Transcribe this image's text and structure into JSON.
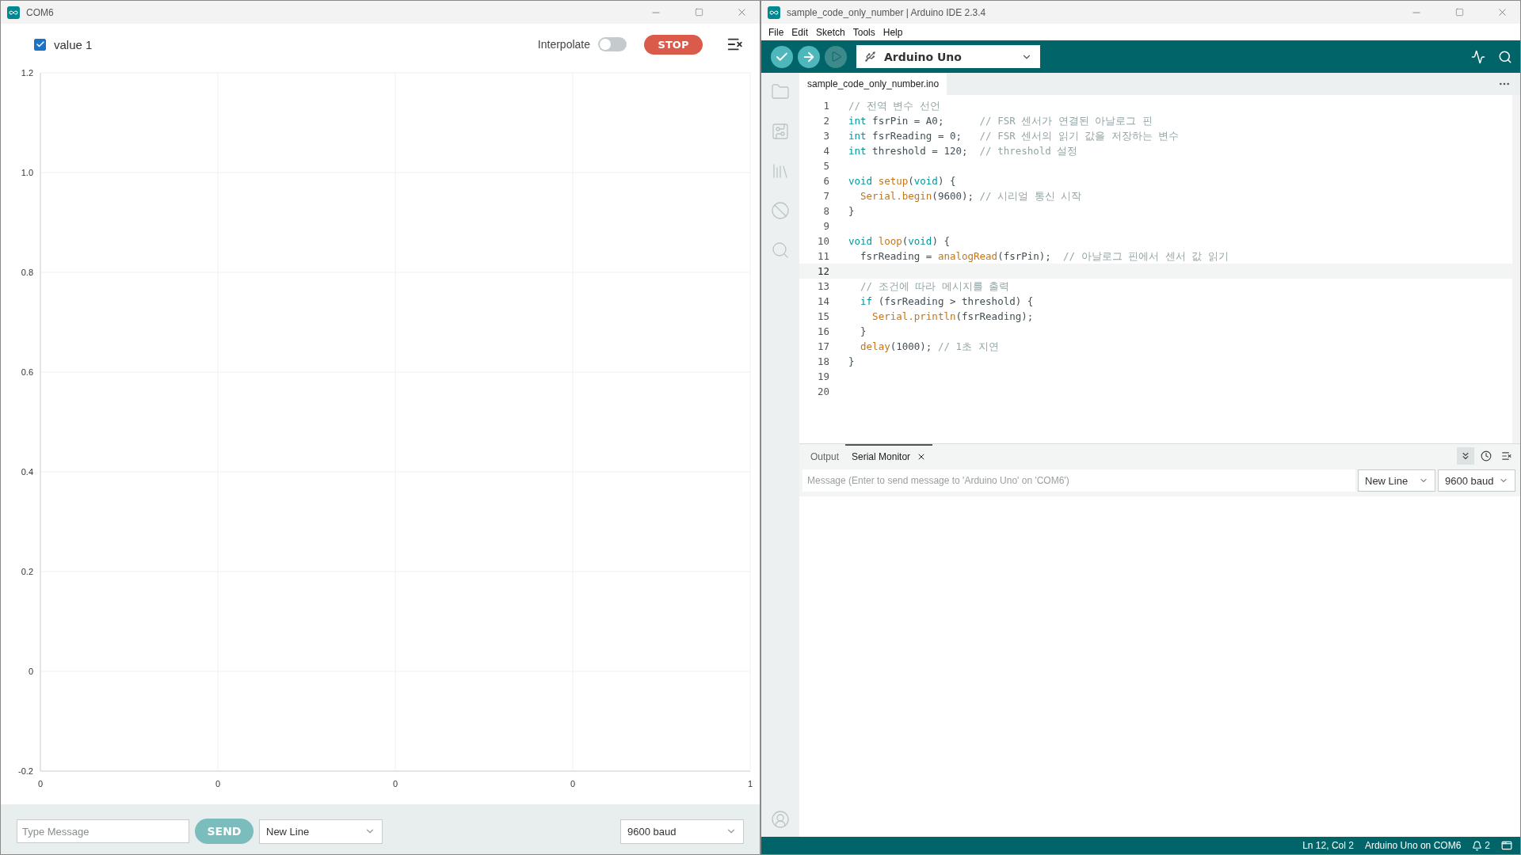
{
  "plotter": {
    "window": {
      "title": "COM6"
    },
    "legend": [
      {
        "label": "value 1",
        "checked": true
      }
    ],
    "interpolate": {
      "label": "Interpolate",
      "on": false
    },
    "stop_button": "STOP",
    "chart_data": {
      "type": "line",
      "grid": true,
      "ylim": [
        -0.2,
        1.2
      ],
      "yticks": [
        {
          "value": 1.2,
          "label": "1.2"
        },
        {
          "value": 1.0,
          "label": "1.0"
        },
        {
          "value": 0.8,
          "label": "0.8"
        },
        {
          "value": 0.6,
          "label": "0.6"
        },
        {
          "value": 0.4,
          "label": "0.4"
        },
        {
          "value": 0.2,
          "label": "0.2"
        },
        {
          "value": 0,
          "label": "0"
        },
        {
          "value": -0.2,
          "label": "-0.2"
        }
      ],
      "categories": [
        "0",
        "0",
        "0",
        "0",
        "1"
      ]
    },
    "message": {
      "placeholder": "Type Message"
    },
    "send_button": "SEND",
    "line_ending": "New Line",
    "baud": "9600 baud"
  },
  "ide": {
    "window": {
      "title": "sample_code_only_number | Arduino IDE 2.3.4"
    },
    "menu": [
      "File",
      "Edit",
      "Sketch",
      "Tools",
      "Help"
    ],
    "board": "Arduino Uno",
    "file_tab": "sample_code_only_number.ino",
    "code": [
      {
        "n": "1",
        "current": false,
        "tokens": [
          {
            "comment": "// 전역 변수 선언"
          }
        ]
      },
      {
        "n": "2",
        "current": false,
        "tokens": [
          {
            "keyword": "int"
          },
          {
            "code": " fsrPin = A0;      "
          },
          {
            "comment": "// FSR 센서가 연결된 아날로그 핀"
          }
        ]
      },
      {
        "n": "3",
        "current": false,
        "tokens": [
          {
            "keyword": "int"
          },
          {
            "code": " fsrReading = 0;   "
          },
          {
            "comment": "// FSR 센서의 읽기 값을 저장하는 변수"
          }
        ]
      },
      {
        "n": "4",
        "current": false,
        "tokens": [
          {
            "keyword": "int"
          },
          {
            "code": " threshold = 120;  "
          },
          {
            "comment": "// threshold 설정"
          }
        ]
      },
      {
        "n": "5",
        "current": false
      },
      {
        "n": "6",
        "current": false,
        "tokens": [
          {
            "keyword": "void"
          },
          {
            "function": " setup"
          },
          {
            "code": "("
          },
          {
            "keyword": "void"
          },
          {
            "code": ") {"
          }
        ]
      },
      {
        "n": "7",
        "current": false,
        "tokens": [
          {
            "function": "  Serial.begin"
          },
          {
            "code": "(9600); "
          },
          {
            "comment": "// 시리얼 통신 시작"
          }
        ]
      },
      {
        "n": "8",
        "current": false,
        "tokens": [
          {
            "code": "}"
          }
        ]
      },
      {
        "n": "9",
        "current": false
      },
      {
        "n": "10",
        "current": false,
        "tokens": [
          {
            "keyword": "void"
          },
          {
            "function": " loop"
          },
          {
            "code": "("
          },
          {
            "keyword": "void"
          },
          {
            "code": ") {"
          }
        ]
      },
      {
        "n": "11",
        "current": false,
        "tokens": [
          {
            "code": "  fsrReading = "
          },
          {
            "function": "analogRead"
          },
          {
            "code": "(fsrPin);  "
          },
          {
            "comment": "// 아날로그 핀에서 센서 값 읽기"
          }
        ]
      },
      {
        "n": "12",
        "current": true
      },
      {
        "n": "13",
        "current": false,
        "tokens": [
          {
            "comment": "  // 조건에 따라 메시지를 출력"
          }
        ]
      },
      {
        "n": "14",
        "current": false,
        "tokens": [
          {
            "keyword": "  if"
          },
          {
            "code": " (fsrReading > threshold) {"
          }
        ]
      },
      {
        "n": "15",
        "current": false,
        "tokens": [
          {
            "function": "    Serial.println"
          },
          {
            "code": "(fsrReading);"
          }
        ]
      },
      {
        "n": "16",
        "current": false,
        "tokens": [
          {
            "code": "  }"
          }
        ]
      },
      {
        "n": "17",
        "current": false,
        "tokens": [
          {
            "function": "  delay"
          },
          {
            "code": "(1000); "
          },
          {
            "comment": "// 1초 지연"
          }
        ]
      },
      {
        "n": "18",
        "current": false,
        "tokens": [
          {
            "code": "}"
          }
        ]
      },
      {
        "n": "19",
        "current": false
      },
      {
        "n": "20",
        "current": false
      }
    ],
    "panel_tabs": [
      {
        "label": "Output",
        "selected": false,
        "closable": false
      },
      {
        "label": "Serial Monitor",
        "selected": true,
        "closable": true
      }
    ],
    "serial_message": {
      "placeholder": "Message (Enter to send message to 'Arduino Uno' on 'COM6')"
    },
    "line_ending": "New Line",
    "baud": "9600 baud",
    "status_bar": {
      "position": "Ln 12, Col 2",
      "board": "Arduino Uno on COM6",
      "notifications": "2"
    }
  }
}
